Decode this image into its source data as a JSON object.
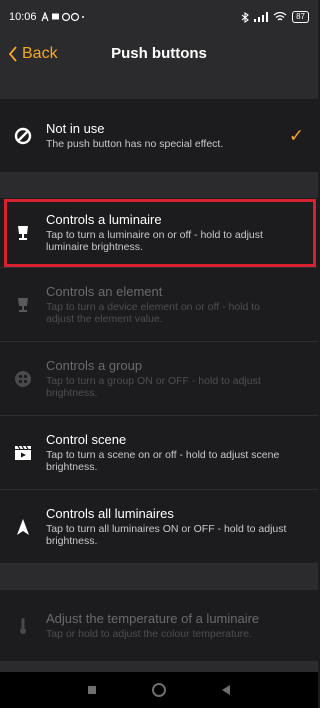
{
  "status": {
    "time": "10:06",
    "battery": "87"
  },
  "nav": {
    "back_label": "Back",
    "title": "Push buttons"
  },
  "options": [
    {
      "title": "Not in use",
      "desc": "The push button has no special effect.",
      "icon": "no-entry-icon",
      "selected": true,
      "enabled": true
    },
    {
      "title": "Controls a luminaire",
      "desc": "Tap to turn a luminaire on or off - hold to adjust luminaire brightness.",
      "icon": "lamp-icon",
      "selected": false,
      "enabled": true
    },
    {
      "title": "Controls an element",
      "desc": "Tap to turn a device element on or off - hold to adjust the element value.",
      "icon": "lamp-icon",
      "selected": false,
      "enabled": false
    },
    {
      "title": "Controls a group",
      "desc": "Tap to turn a group ON or OFF - hold to adjust brightness.",
      "icon": "group-icon",
      "selected": false,
      "enabled": false
    },
    {
      "title": "Control scene",
      "desc": "Tap to turn a scene on or off - hold to adjust scene brightness.",
      "icon": "clapperboard-icon",
      "selected": false,
      "enabled": true
    },
    {
      "title": "Controls all luminaires",
      "desc": "Tap to turn all luminaires ON or OFF - hold to adjust brightness.",
      "icon": "cone-icon",
      "selected": false,
      "enabled": true
    },
    {
      "title": "Adjust the temperature of a luminaire",
      "desc": "Tap or hold to adjust the colour temperature.",
      "icon": "thermometer-icon",
      "selected": false,
      "enabled": false
    }
  ],
  "check_glyph": "✓",
  "colors": {
    "accent": "#f5a623",
    "highlight": "#d6212e"
  }
}
